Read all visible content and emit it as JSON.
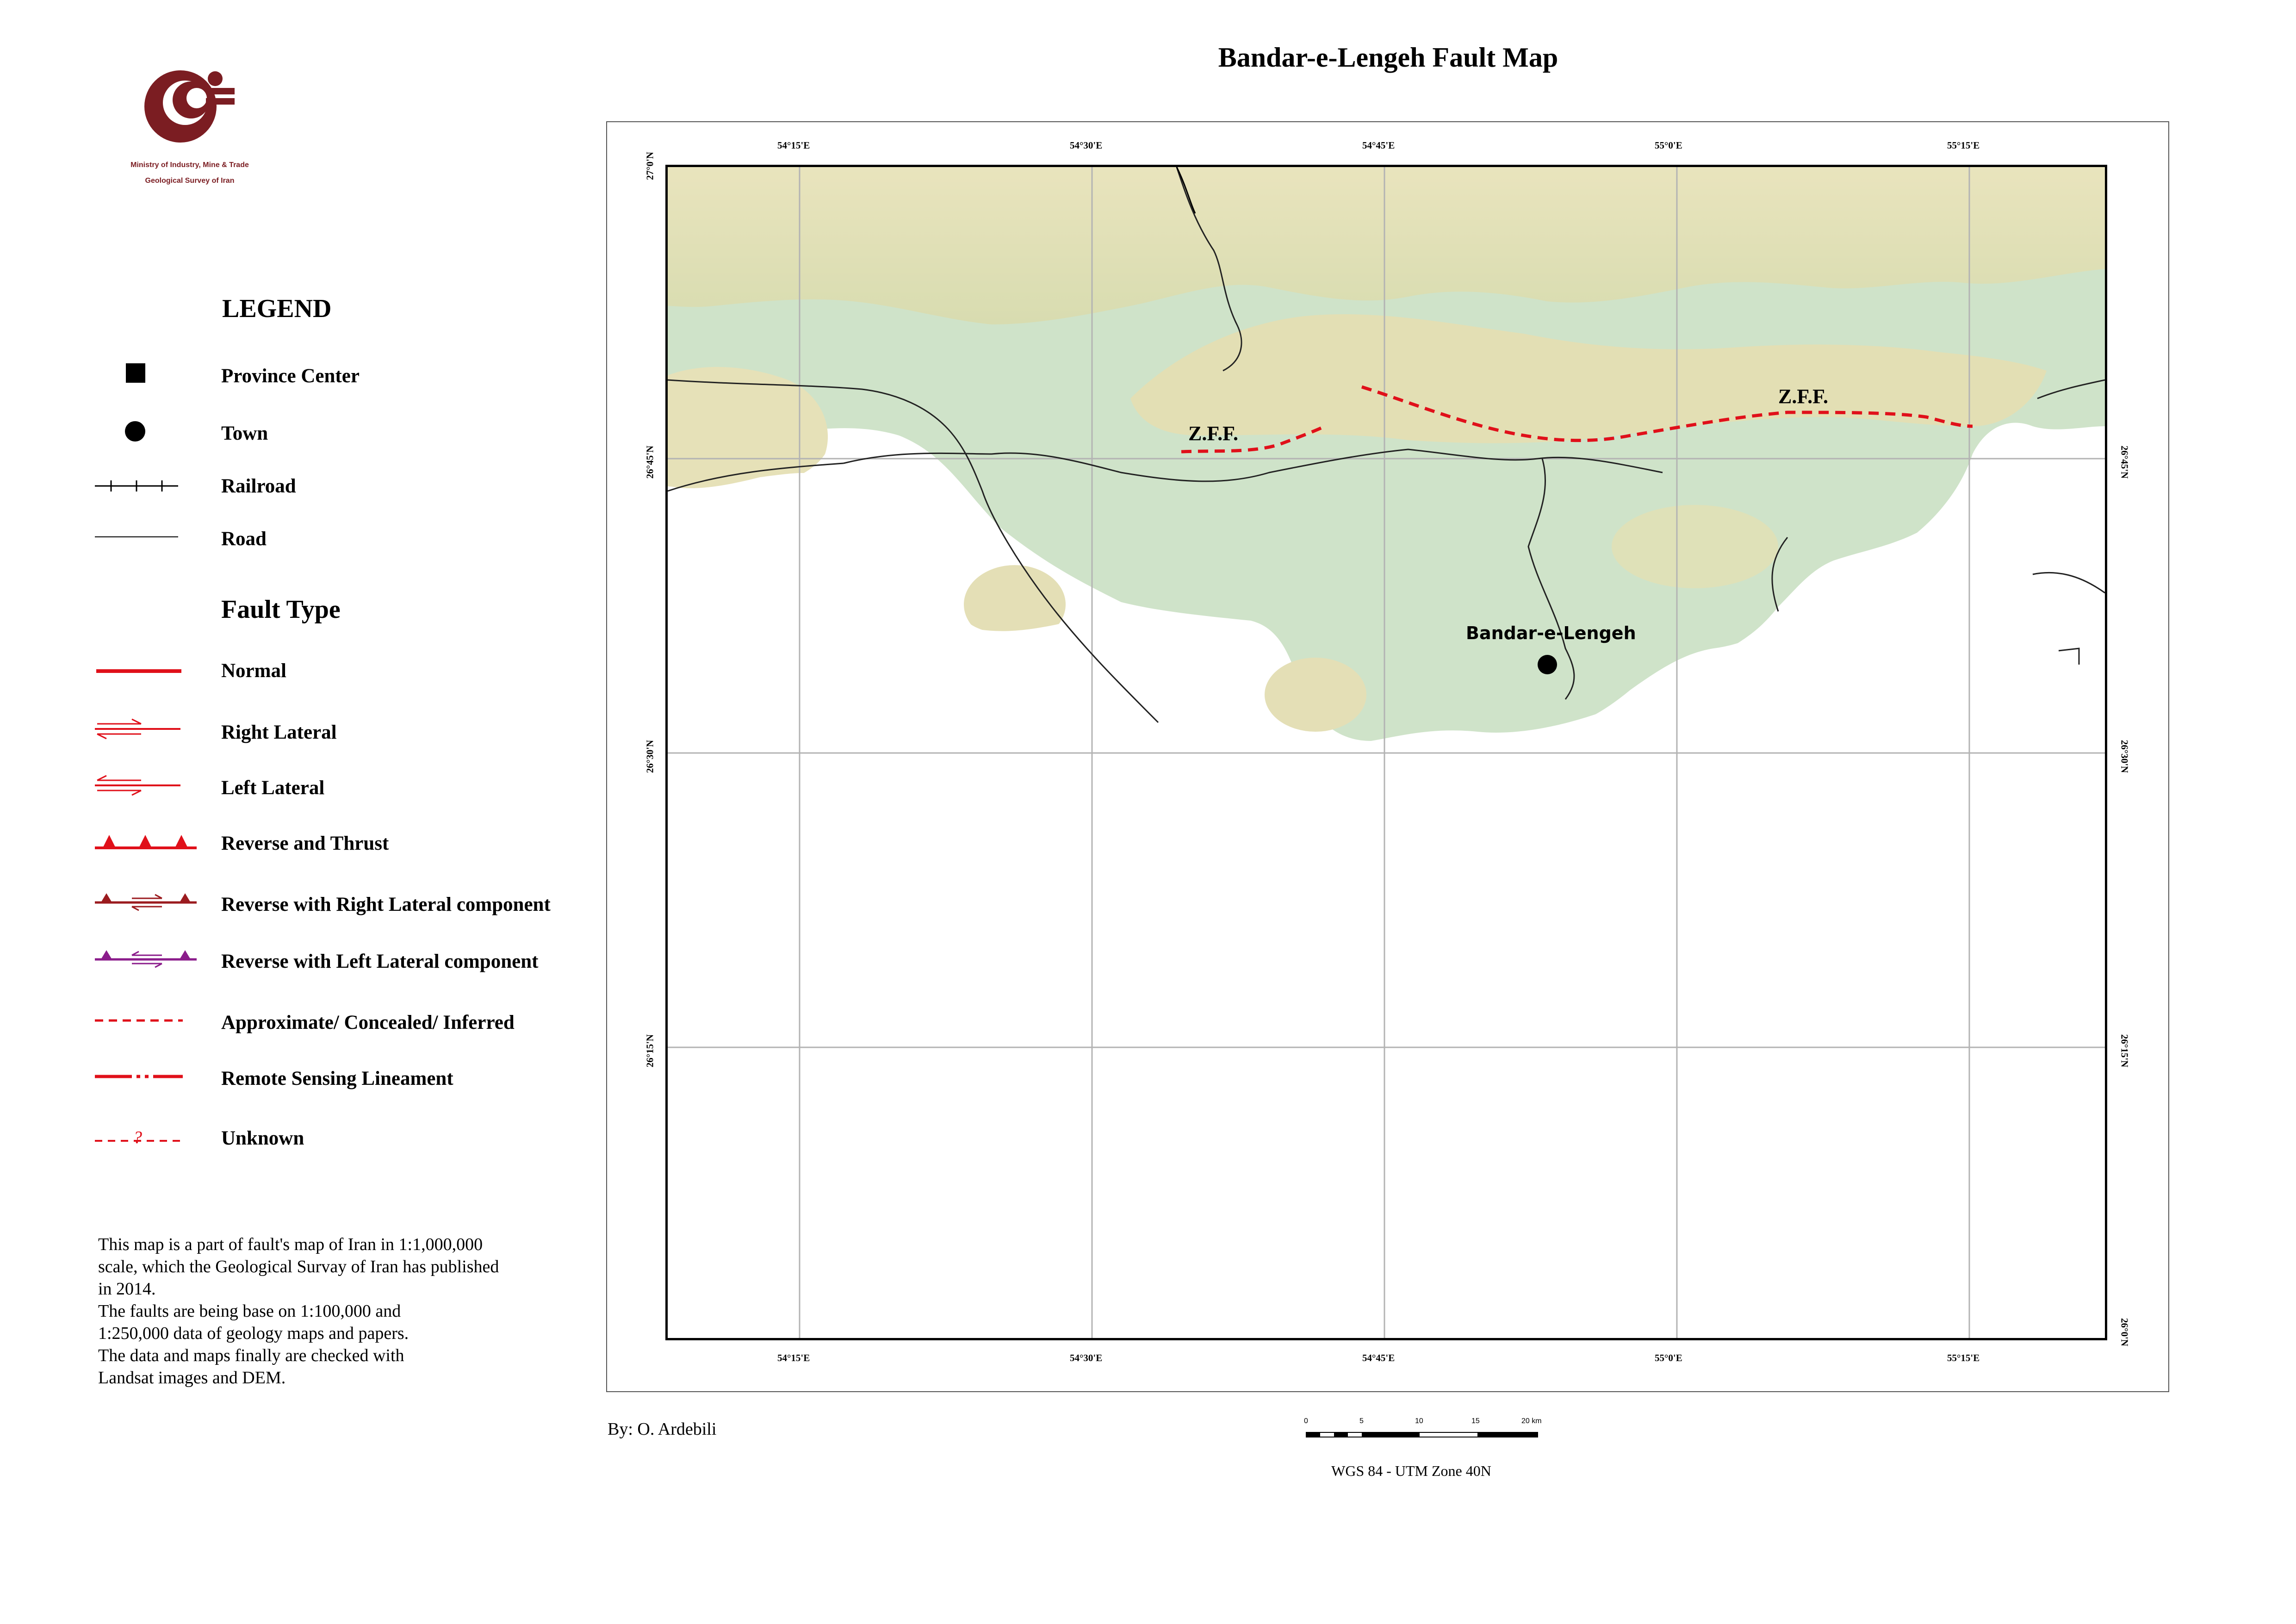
{
  "header": {
    "title": "Bandar-e-Lengeh Fault Map"
  },
  "organization": {
    "line1": "Ministry of Industry, Mine & Trade",
    "line2": "Geological Survey of Iran"
  },
  "legend": {
    "title": "LEGEND",
    "fault_type_title": "Fault Type",
    "items": [
      {
        "label": "Province Center",
        "icon": "square-icon"
      },
      {
        "label": "Town",
        "icon": "circle-icon"
      },
      {
        "label": "Railroad",
        "icon": "railroad-line-icon"
      },
      {
        "label": "Road",
        "icon": "road-line-icon"
      }
    ],
    "fault_items": [
      {
        "label": "Normal",
        "icon": "normal-fault-icon"
      },
      {
        "label": "Right Lateral",
        "icon": "right-lateral-fault-icon"
      },
      {
        "label": "Left Lateral",
        "icon": "left-lateral-fault-icon"
      },
      {
        "label": "Reverse and Thrust",
        "icon": "thrust-fault-icon"
      },
      {
        "label": "Reverse with Right Lateral component",
        "icon": "reverse-right-lateral-icon"
      },
      {
        "label": "Reverse with Left Lateral component",
        "icon": "reverse-left-lateral-icon"
      },
      {
        "label": "Approximate/ Concealed/ Inferred",
        "icon": "dashed-fault-icon"
      },
      {
        "label": "Remote Sensing Lineament",
        "icon": "lineament-icon"
      },
      {
        "label": "Unknown",
        "icon": "unknown-fault-icon"
      }
    ],
    "colors": {
      "fault_red": "#e0101a",
      "reverse_dark": "#9b1b1f",
      "reverse_purple": "#8b1c8b"
    }
  },
  "note": {
    "lines": [
      "This map is a part of fault's map of Iran in 1:1,000,000",
      "scale, which the Geological Survay of Iran has published",
      "in 2014.",
      "The faults are being base on 1:100,000 and",
      "1:250,000 data of geology maps and papers.",
      "The data and maps finally are checked with",
      "Landsat images and DEM."
    ]
  },
  "map": {
    "lon_labels": [
      "54°15'E",
      "54°30'E",
      "54°45'E",
      "55°0'E",
      "55°15'E"
    ],
    "lat_labels": [
      "27°0'N",
      "26°45'N",
      "26°30'N",
      "26°15'N",
      "26°0'N"
    ],
    "town_label": "Bandar-e-Lengeh",
    "fault_labels": [
      "Z.F.F.",
      "Z.F.F."
    ],
    "colors": {
      "lowland": "#cfe3c9",
      "highland": "#e2deb4",
      "sea": "#ffffff",
      "grid": "#b3b3b3"
    }
  },
  "footer": {
    "author": "By: O. Ardebili",
    "projection": "WGS 84 - UTM Zone 40N",
    "scale_labels": [
      "0",
      "5",
      "10",
      "15",
      "20 km"
    ]
  }
}
